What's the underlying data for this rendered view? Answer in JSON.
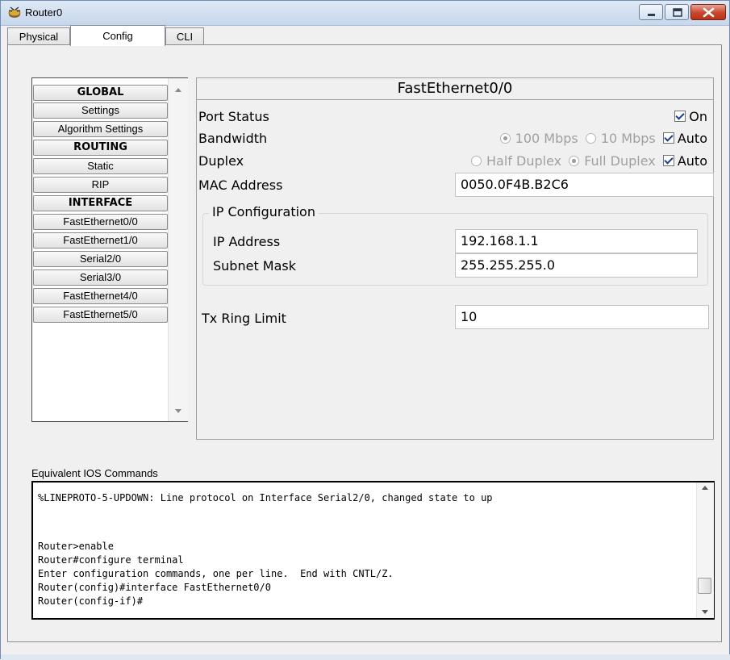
{
  "window": {
    "title": "Router0"
  },
  "tabs": [
    {
      "label": "Physical"
    },
    {
      "label": "Config"
    },
    {
      "label": "CLI"
    }
  ],
  "sidebar": {
    "items": [
      {
        "label": "GLOBAL",
        "header": true
      },
      {
        "label": "Settings"
      },
      {
        "label": "Algorithm Settings"
      },
      {
        "label": "ROUTING",
        "header": true
      },
      {
        "label": "Static"
      },
      {
        "label": "RIP"
      },
      {
        "label": "INTERFACE",
        "header": true
      },
      {
        "label": "FastEthernet0/0"
      },
      {
        "label": "FastEthernet1/0"
      },
      {
        "label": "Serial2/0"
      },
      {
        "label": "Serial3/0"
      },
      {
        "label": "FastEthernet4/0"
      },
      {
        "label": "FastEthernet5/0"
      }
    ]
  },
  "interface": {
    "title": "FastEthernet0/0",
    "port_status_label": "Port Status",
    "port_status_on_label": "On",
    "bandwidth_label": "Bandwidth",
    "bw_100": "100 Mbps",
    "bw_10": "10 Mbps",
    "bw_auto": "Auto",
    "duplex_label": "Duplex",
    "half_duplex": "Half Duplex",
    "full_duplex": "Full Duplex",
    "duplex_auto": "Auto",
    "mac_label": "MAC Address",
    "mac_value": "0050.0F4B.B2C6",
    "ip_config_title": "IP Configuration",
    "ip_label": "IP Address",
    "ip_value": "192.168.1.1",
    "mask_label": "Subnet Mask",
    "mask_value": "255.255.255.0",
    "tx_label": "Tx Ring Limit",
    "tx_value": "10"
  },
  "ios": {
    "label": "Equivalent IOS Commands",
    "lines": [
      "%LINEPROTO-5-UPDOWN: Line protocol on Interface Serial2/0, changed state to up",
      "",
      "",
      "Router>enable",
      "Router#configure terminal",
      "Enter configuration commands, one per line.  End with CNTL/Z.",
      "Router(config)#interface FastEthernet0/0",
      "Router(config-if)#"
    ]
  }
}
